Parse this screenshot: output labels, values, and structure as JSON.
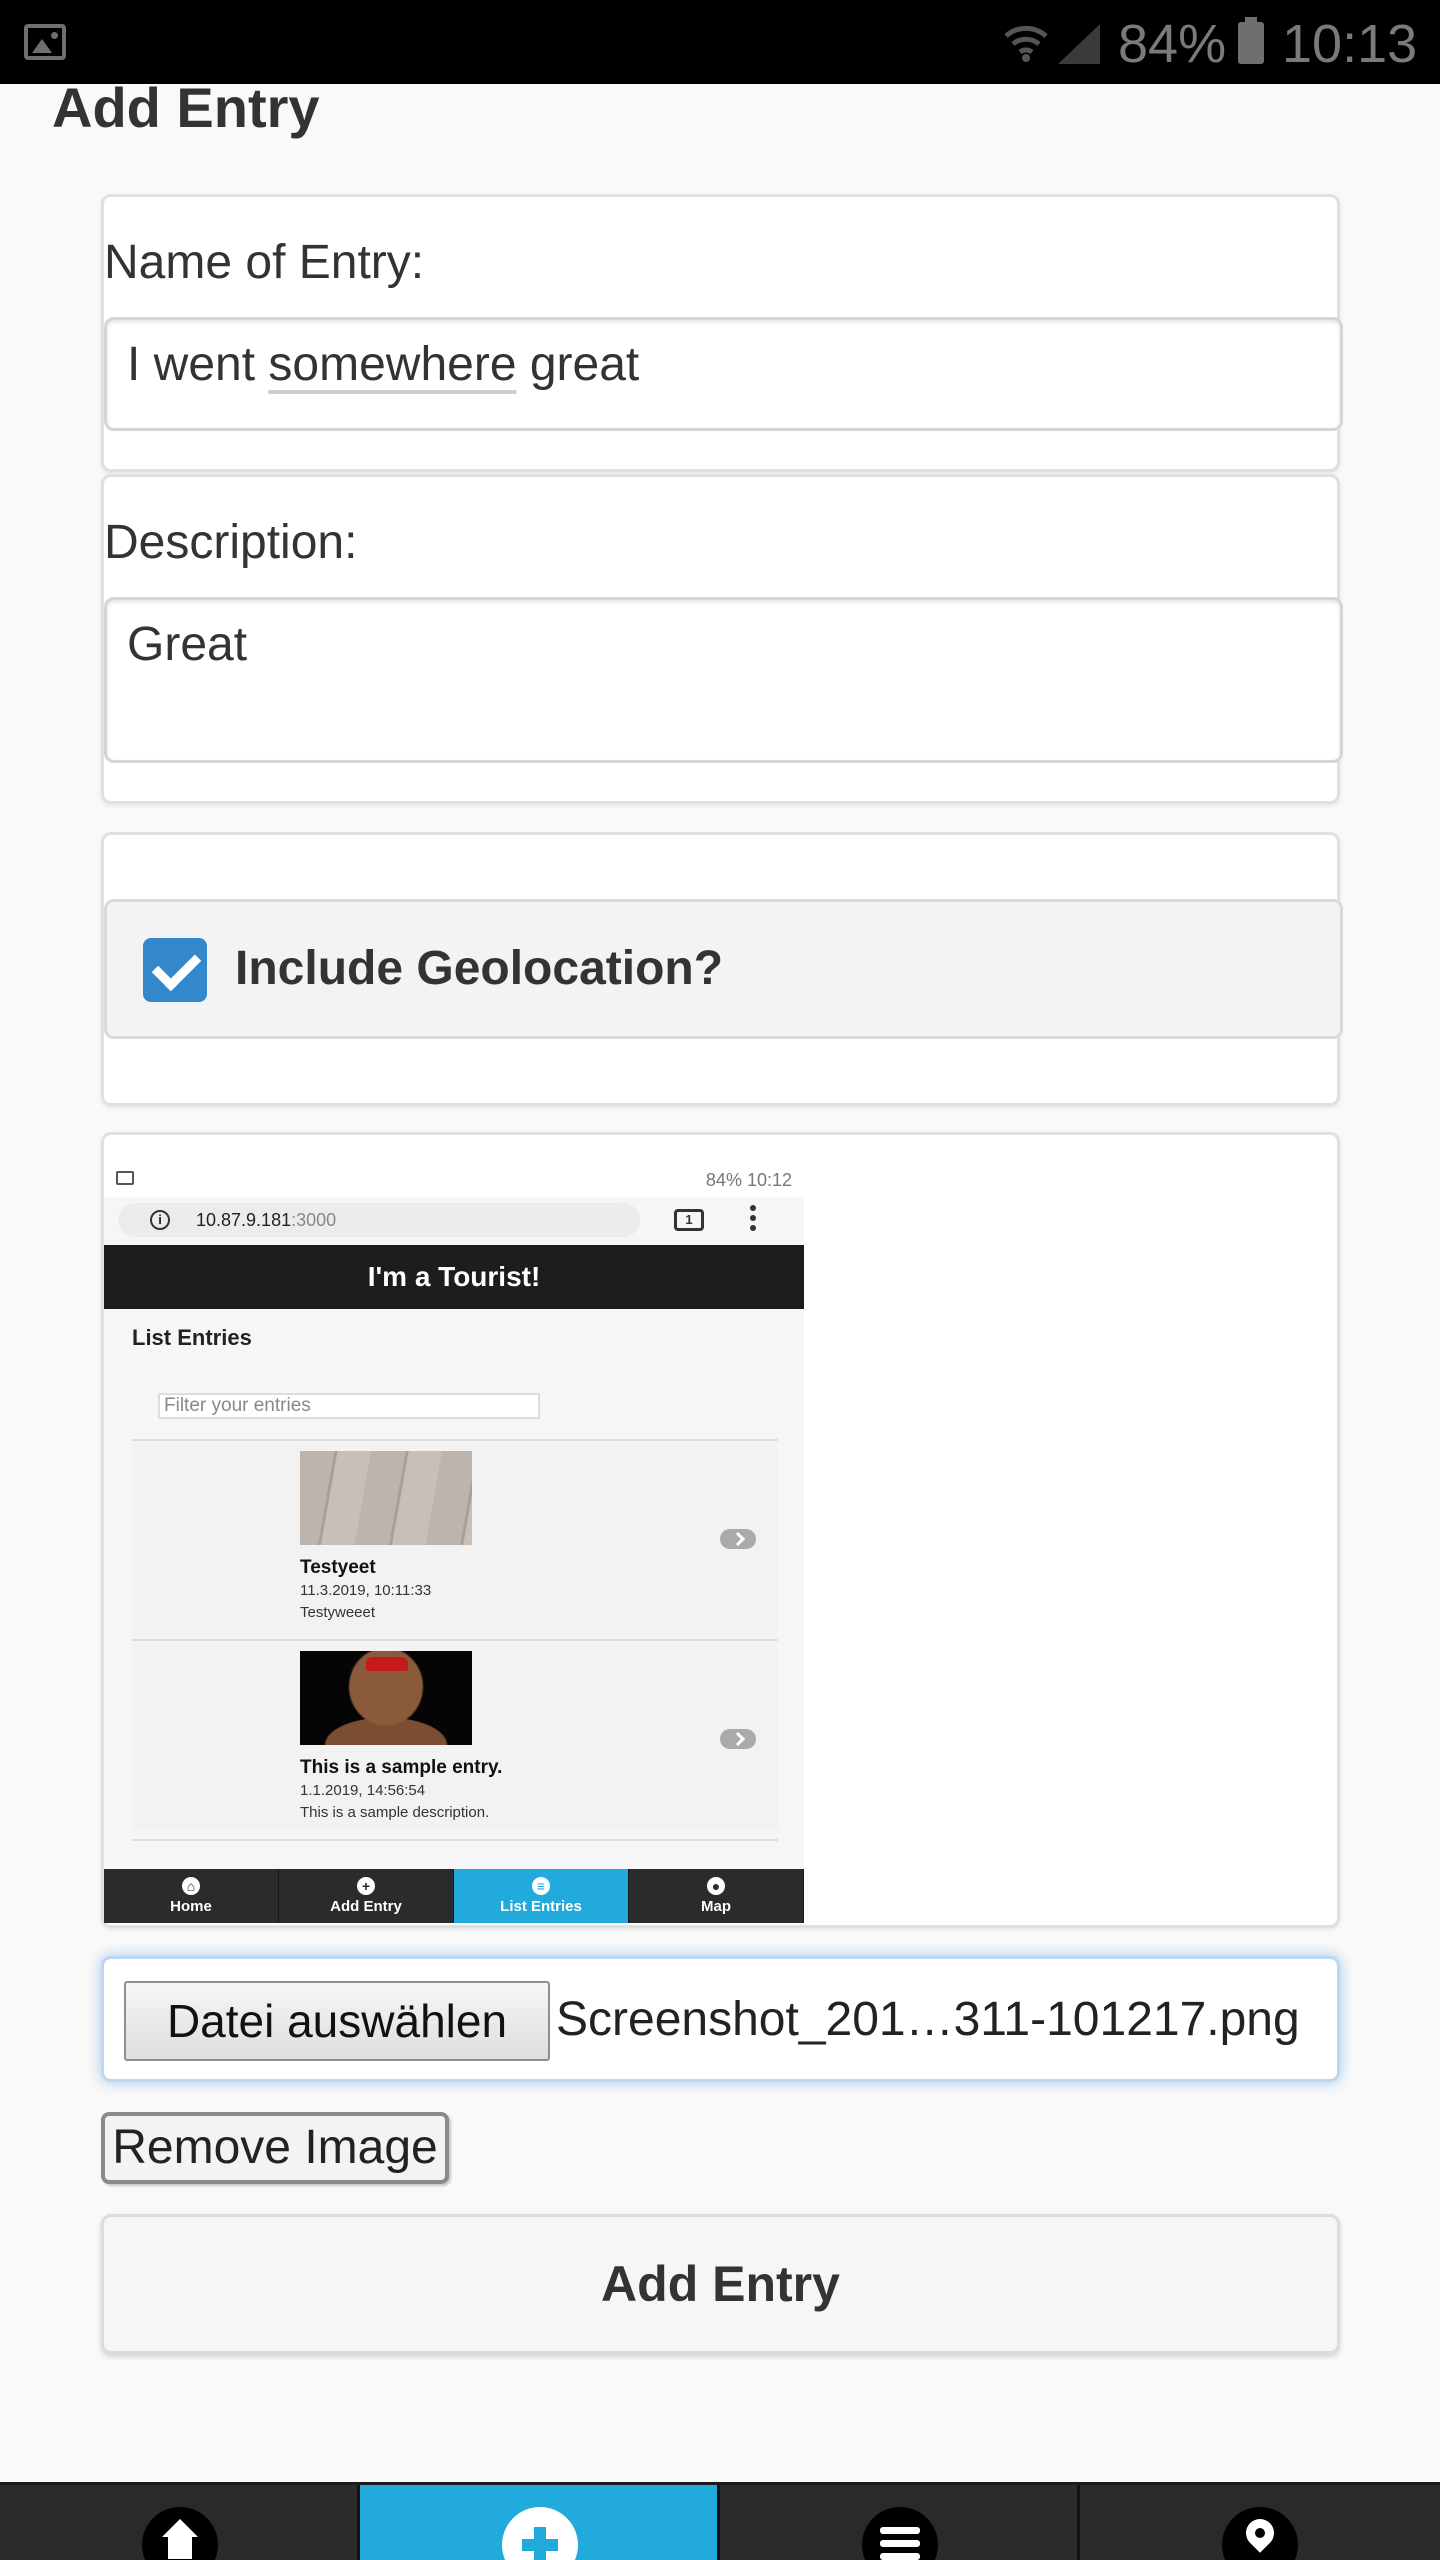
{
  "status_bar": {
    "battery": "84%",
    "time": "10:13"
  },
  "page": {
    "title": "Add Entry"
  },
  "form": {
    "name_label": "Name of Entry:",
    "name_value_prefix": "I went ",
    "name_value_misspelled": "somewhere",
    "name_value_suffix": " great",
    "description_label": "Description:",
    "description_value": "Great",
    "geolocation_label": "Include Geolocation?",
    "geolocation_checked": true,
    "file_button": "Datei auswählen",
    "file_name": "Screenshot_201…311-101217.png",
    "remove_image": "Remove Image",
    "submit": "Add Entry"
  },
  "preview": {
    "status_text": "84% 10:12",
    "url_host": "10.87.9.181",
    "url_port": ":3000",
    "tab_count": "1",
    "app_header": "I'm a Tourist!",
    "list_title": "List Entries",
    "filter_placeholder": "Filter your entries",
    "entries": [
      {
        "name": "Testyeet",
        "date": "11.3.2019, 10:11:33",
        "description": "Testyweeet"
      },
      {
        "name": "This is a sample entry.",
        "date": "1.1.2019, 14:56:54",
        "description": "This is a sample description."
      }
    ],
    "nav": [
      "Home",
      "Add Entry",
      "List Entries",
      "Map"
    ],
    "nav_active": "List Entries"
  },
  "navbar": {
    "items": [
      {
        "icon": "home-icon"
      },
      {
        "icon": "plus-icon",
        "active": true
      },
      {
        "icon": "list-icon"
      },
      {
        "icon": "map-pin-icon"
      }
    ],
    "accent": "#22aadd"
  }
}
